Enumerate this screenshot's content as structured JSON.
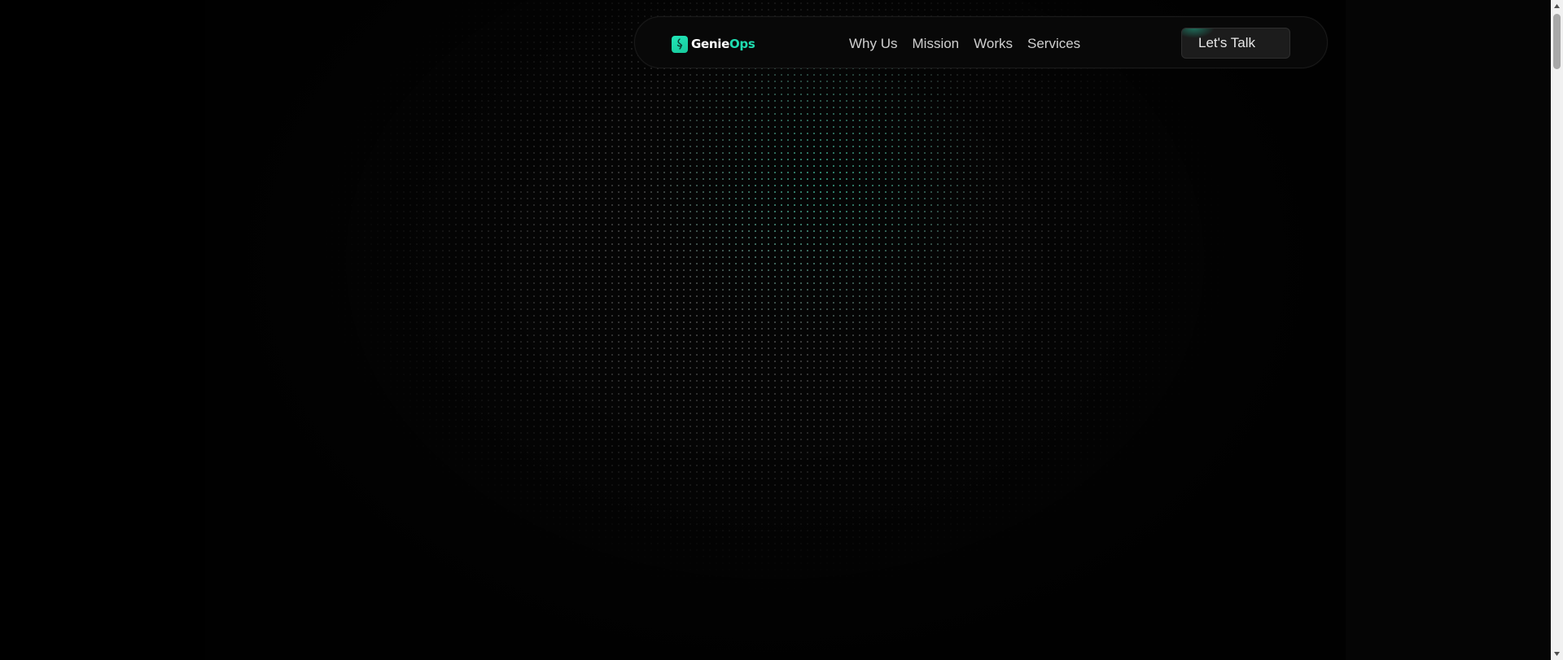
{
  "brand": {
    "name_part1": "Genie",
    "name_part2": "Ops",
    "icon": "genie-lamp-icon",
    "accent_color": "#1fdcb0"
  },
  "nav": {
    "items": [
      {
        "label": "Why Us"
      },
      {
        "label": "Mission"
      },
      {
        "label": "Works"
      },
      {
        "label": "Services"
      }
    ]
  },
  "cta": {
    "label": "Let's Talk"
  },
  "theme": {
    "background": "#000000",
    "panel": "#050505",
    "dot_color": "#bebebe",
    "dot_accent": "#1cdcaa"
  },
  "scrollbar": {
    "icons": [
      "scroll-up-arrow-icon",
      "scroll-down-arrow-icon"
    ]
  }
}
